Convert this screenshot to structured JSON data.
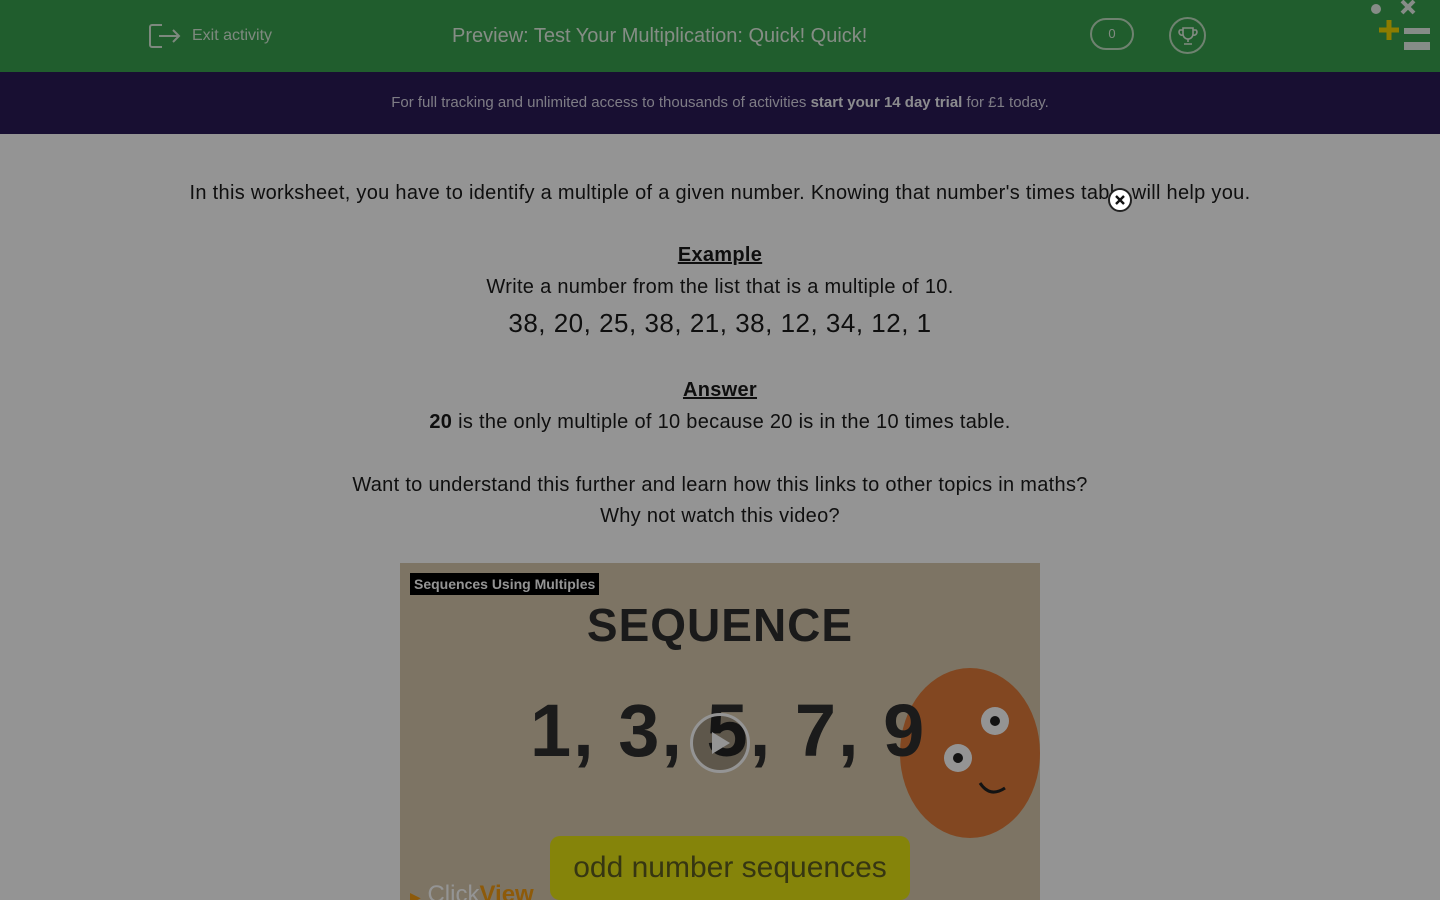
{
  "header": {
    "exit_label": "Exit activity",
    "title": "Preview: Test Your Multiplication: Quick! Quick!",
    "score": "0"
  },
  "banner": {
    "text_before": "For full tracking and unlimited access to thousands of activities ",
    "cta": "start your 14 day trial",
    "text_after": " for £1 today."
  },
  "intro": {
    "text": "In this worksheet, you have to identify a multiple of a given number. Knowing that number's times table will help you."
  },
  "example": {
    "heading": "Example",
    "question": "Write a number from the list that is a multiple of 10.",
    "numbers": "38, 20, 25, 38, 21, 38, 12, 34, 12, 1"
  },
  "answer": {
    "heading": "Answer",
    "bold": "20",
    "text": " is the only multiple of 10 because 20 is in the 10 times table."
  },
  "video_prompt": {
    "line1": "Want to understand this further and learn how this links to other topics in maths?",
    "line2": "Why not watch this video?"
  },
  "video": {
    "title": "Sequences Using Multiples",
    "frame_heading": "SEQUENCE",
    "frame_numbers": "1, 3, 5, 7, 9",
    "caption": "odd number sequences",
    "brand_part1": "Click",
    "brand_part2": "View"
  },
  "colors": {
    "header_bg": "#38a14e",
    "banner_bg": "#2a1a57",
    "caption_bg": "#e5e312",
    "brand_accent": "#f39c12"
  }
}
